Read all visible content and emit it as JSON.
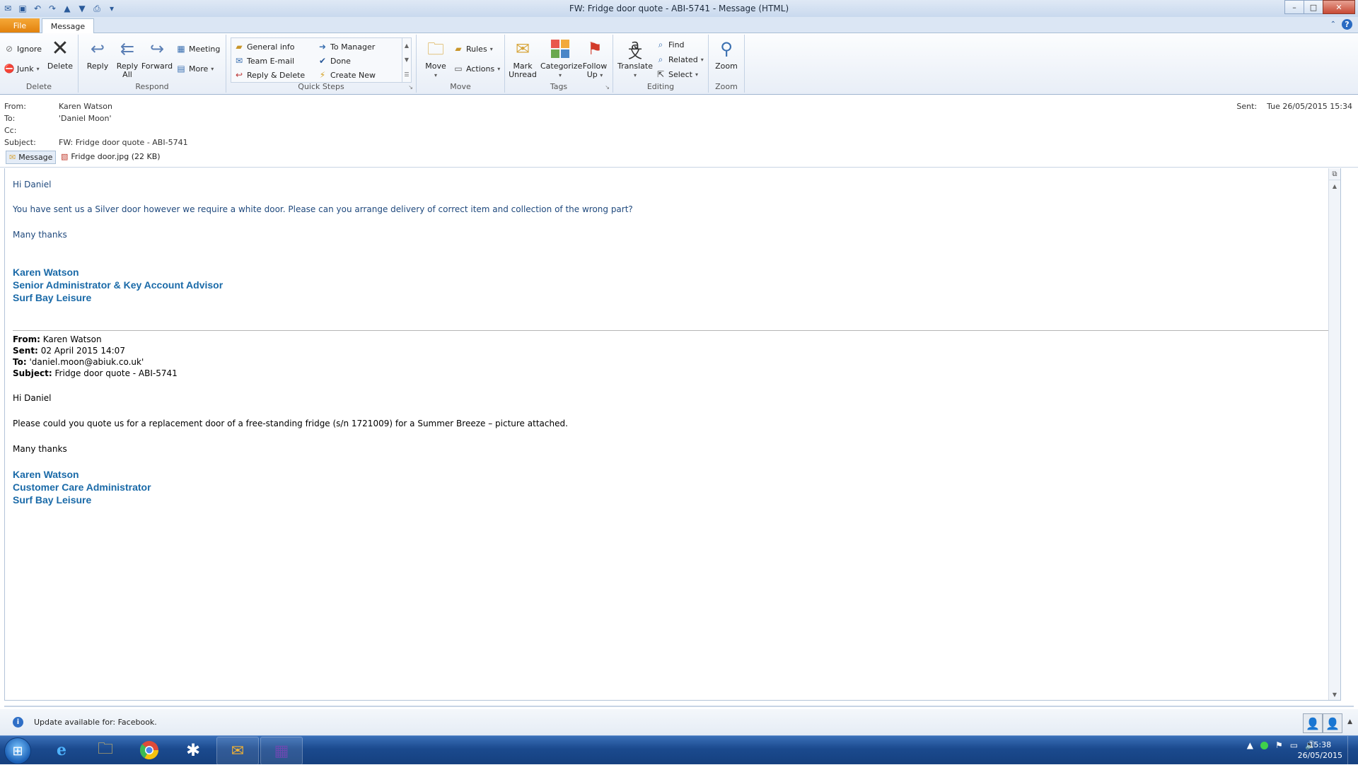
{
  "window": {
    "title": "FW: Fridge door quote - ABI-5741  -  Message (HTML)",
    "controls": {
      "minimize": "–",
      "maximize": "□",
      "close": "✕"
    }
  },
  "tabs": {
    "file": "File",
    "message": "Message"
  },
  "ribbon": {
    "delete": {
      "label": "Delete",
      "ignore": "Ignore",
      "junk": "Junk",
      "delete_btn": "Delete"
    },
    "respond": {
      "label": "Respond",
      "reply": "Reply",
      "reply_all_1": "Reply",
      "reply_all_2": "All",
      "forward": "Forward",
      "meeting": "Meeting",
      "more": "More"
    },
    "quick_steps": {
      "label": "Quick Steps",
      "items": [
        "General info",
        "To Manager",
        "Team E-mail",
        "Done",
        "Reply & Delete",
        "Create New"
      ]
    },
    "move": {
      "label": "Move",
      "move_btn": "Move",
      "rules": "Rules",
      "actions": "Actions"
    },
    "tags": {
      "label": "Tags",
      "mark_unread_1": "Mark",
      "mark_unread_2": "Unread",
      "categorize": "Categorize",
      "follow_up_1": "Follow",
      "follow_up_2": "Up"
    },
    "editing": {
      "label": "Editing",
      "translate": "Translate",
      "find": "Find",
      "related": "Related",
      "select": "Select"
    },
    "zoom": {
      "label": "Zoom",
      "zoom_btn": "Zoom"
    }
  },
  "header": {
    "from_label": "From:",
    "from": "Karen Watson",
    "to_label": "To:",
    "to": "'Daniel Moon'",
    "cc_label": "Cc:",
    "cc": "",
    "subject_label": "Subject:",
    "subject": "FW: Fridge door quote - ABI-5741",
    "sent_label": "Sent:",
    "sent": "Tue 26/05/2015 15:34"
  },
  "attachments": {
    "message_tab": "Message",
    "file": "Fridge door.jpg (22 KB)"
  },
  "body": {
    "greeting": "Hi Daniel",
    "paragraph": "You have sent us a Silver door however we require a white door. Please can you arrange delivery of correct item and collection of the wrong part?",
    "closing": "Many thanks",
    "sig_name": "Karen Watson",
    "sig_title": "Senior Administrator & Key Account Advisor",
    "sig_company": "Surf Bay Leisure",
    "fwd": {
      "from_label": "From:",
      "from": "Karen Watson",
      "sent_label": "Sent:",
      "sent": "02 April 2015 14:07",
      "to_label": "To:",
      "to": "'daniel.moon@abiuk.co.uk'",
      "subject_label": "Subject:",
      "subject": "Fridge door quote - ABI-5741",
      "greeting": "Hi Daniel",
      "paragraph": "Please could you quote us for  a replacement door of a free-standing fridge (s/n 1721009) for a Summer Breeze – picture attached.",
      "closing": "Many thanks",
      "sig_name": "Karen Watson",
      "sig_title": "Customer Care Administrator",
      "sig_company": "Surf Bay Leisure"
    }
  },
  "infobar": {
    "text": "Update available for: Facebook."
  },
  "taskbar": {
    "time": "15:38",
    "date": "26/05/2015"
  },
  "colors": {
    "accent": "#1a6aa8",
    "body_text": "#1f497d",
    "file_tab": "#e98f19",
    "taskbar": "#1b4a8e"
  },
  "icons": [
    "save-icon",
    "undo-icon",
    "redo-icon",
    "up-icon",
    "down-icon",
    "ignore-icon",
    "junk-icon",
    "delete-icon",
    "reply-icon",
    "reply-all-icon",
    "forward-icon",
    "meeting-icon",
    "more-icon",
    "rules-icon",
    "actions-icon",
    "mark-unread-icon",
    "categorize-icon",
    "follow-up-icon",
    "translate-icon",
    "find-icon",
    "related-icon",
    "select-icon",
    "zoom-icon",
    "info-icon"
  ]
}
